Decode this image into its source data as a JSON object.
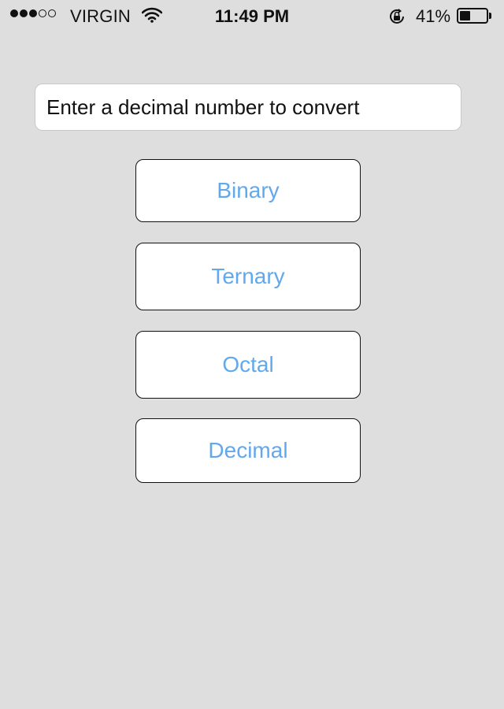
{
  "status_bar": {
    "carrier": "VIRGIN",
    "time": "11:49 PM",
    "battery_percent": "41%",
    "battery_level": 0.41,
    "signal_strength": 3,
    "signal_max": 5,
    "icons": [
      "signal-dots-icon",
      "wifi-icon",
      "orientation-lock-icon",
      "battery-icon"
    ]
  },
  "converter": {
    "input_placeholder": "Enter a decimal number to convert",
    "input_value": "",
    "buttons": [
      "Binary",
      "Ternary",
      "Octal",
      "Decimal"
    ]
  },
  "colors": {
    "background": "#dedede",
    "button_text": "#62a8ec",
    "button_border": "#111111"
  }
}
